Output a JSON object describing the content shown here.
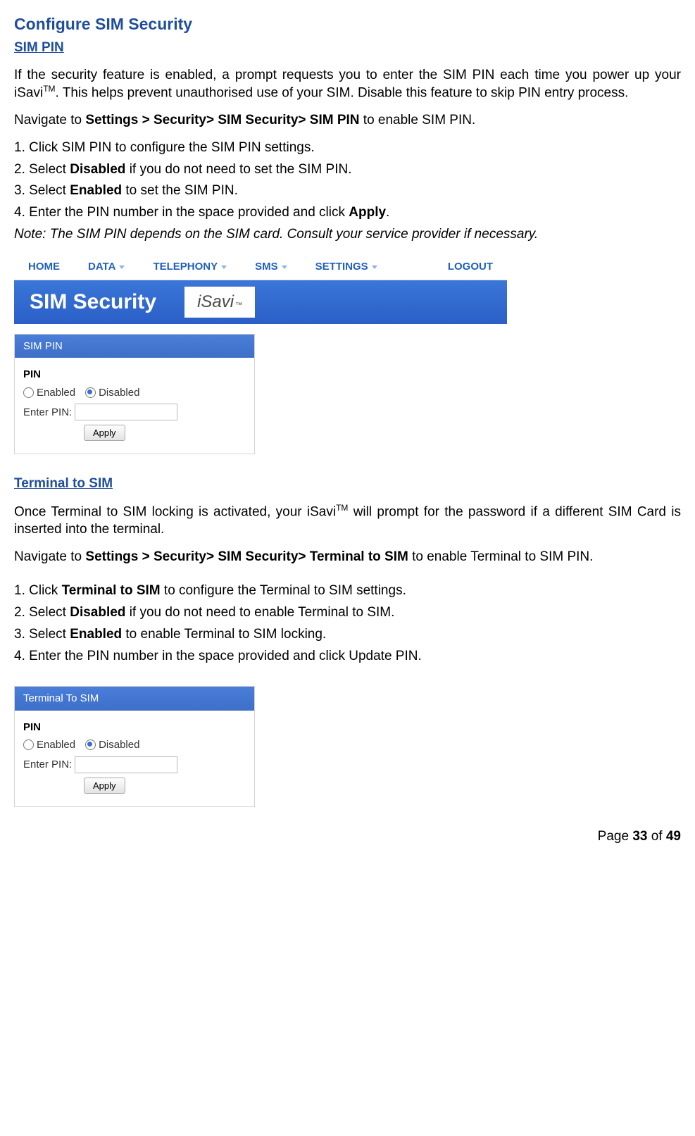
{
  "title": "Configure SIM Security",
  "section1": {
    "heading": "SIM PIN",
    "p1_a": "If the security feature is enabled, a prompt requests you to enter the SIM PIN each time you power up your iSavi",
    "p1_b": ". This helps prevent unauthorised use of your SIM. Disable this feature to skip PIN entry process.",
    "nav_a": "Navigate to ",
    "nav_b": "Settings > Security> SIM Security> SIM PIN",
    "nav_c": " to enable SIM PIN.",
    "step1": "1. Click SIM PIN to configure the SIM PIN settings.",
    "step2a": "2. Select ",
    "step2b": "Disabled",
    "step2c": " if you do not need to set the SIM PIN.",
    "step3a": "3. Select ",
    "step3b": "Enabled",
    "step3c": " to set the SIM PIN.",
    "step4a": "4. Enter the PIN number in the space provided and click ",
    "step4b": "Apply",
    "step4c": ".",
    "note": "Note: The SIM PIN depends on the SIM card. Consult your service provider if necessary."
  },
  "navmenu": {
    "home": "HOME",
    "data": "DATA",
    "tel": "TELEPHONY",
    "sms": "SMS",
    "settings": "SETTINGS",
    "logout": "LOGOUT"
  },
  "banner": {
    "title": "SIM Security",
    "logo": "iSavi",
    "tm": "™"
  },
  "panel1": {
    "header": "SIM PIN",
    "pin": "PIN",
    "enabled": "Enabled",
    "disabled": "Disabled",
    "enter": "Enter PIN:",
    "apply": "Apply"
  },
  "section2": {
    "heading": "Terminal to SIM",
    "p1_a": "Once Terminal to SIM locking is activated, your iSavi",
    "p1_b": " will prompt for the password if a different SIM Card is inserted into the terminal.",
    "nav_a": "Navigate to ",
    "nav_b": "Settings > Security> SIM Security> Terminal to SIM",
    "nav_c": " to enable Terminal to SIM PIN.",
    "step1a": "1. Click ",
    "step1b": "Terminal to SIM",
    "step1c": " to configure the Terminal to SIM settings.",
    "step2a": "2. Select ",
    "step2b": "Disabled",
    "step2c": " if you do not need to enable Terminal to SIM.",
    "step3a": "3. Select ",
    "step3b": "Enabled",
    "step3c": " to enable Terminal to SIM locking.",
    "step4": "4. Enter the PIN number in the space provided and click Update PIN."
  },
  "panel2": {
    "header": "Terminal To SIM",
    "pin": "PIN",
    "enabled": "Enabled",
    "disabled": "Disabled",
    "enter": "Enter PIN:",
    "apply": "Apply"
  },
  "footer": {
    "a": "Page ",
    "b": "33",
    "c": " of ",
    "d": "49"
  },
  "tm": "TM"
}
